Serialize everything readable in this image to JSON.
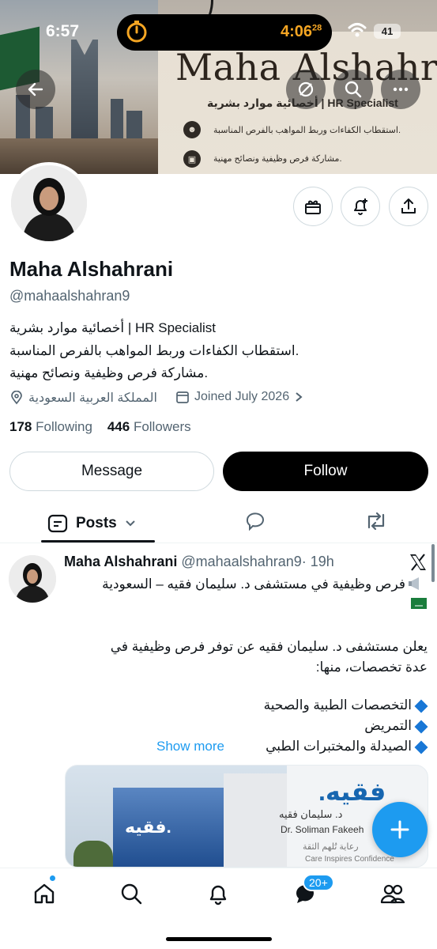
{
  "status_bar": {
    "time": "6:57",
    "timer_time": "4:06",
    "timer_seconds": "28",
    "battery": "41"
  },
  "banner": {
    "title": "Maha Alshahrani",
    "subtitle": "أخصائية موارد بشرية | HR Specialist",
    "line1": "استقطاب الكفاءات وربط المواهب بالفرص المناسبة.",
    "line2": "مشاركة فرص وظيفية ونصائح مهنية."
  },
  "profile": {
    "name": "Maha Alshahrani",
    "handle": "@mahaalshahran9",
    "bio_line1": "أخصائية موارد بشرية | HR Specialist",
    "bio_line2": "استقطاب الكفاءات وربط المواهب بالفرص المناسبة.",
    "bio_line3": "مشاركة فرص وظيفية ونصائح مهنية.",
    "location": "المملكة العربية السعودية",
    "joined": "Joined July 2026",
    "following_count": "178",
    "following_label": "Following",
    "followers_count": "446",
    "followers_label": "Followers"
  },
  "actions": {
    "message": "Message",
    "follow": "Follow"
  },
  "tabs": {
    "posts": "Posts"
  },
  "post": {
    "author": "Maha Alshahrani",
    "handle": "@mahaalshahran9",
    "time": "· 19h",
    "line1": "فرص وظيفية في مستشفى د. سليمان فقيه – السعودية",
    "line2": "يعلن مستشفى د. سليمان فقيه عن توفر فرص وظيفية في",
    "line3": "عدة تخصصات، منها:",
    "item1": "التخصصات الطبية والصحية",
    "item2": "التمريض",
    "item3": "الصيدلة والمختبرات الطبي",
    "show_more": "Show more",
    "image_brand": "فقيه.",
    "image_name_ar": "د. سليمان فقيه",
    "image_name_en": "Dr. Soliman Fakeeh",
    "image_tagline_ar": "رعاية تُلهم الثقة",
    "image_tagline_en": "Care Inspires Confidence"
  },
  "nav": {
    "messages_badge": "20+"
  },
  "colors": {
    "accent": "#1d9bf0",
    "text": "#0f1419",
    "muted": "#536471"
  }
}
